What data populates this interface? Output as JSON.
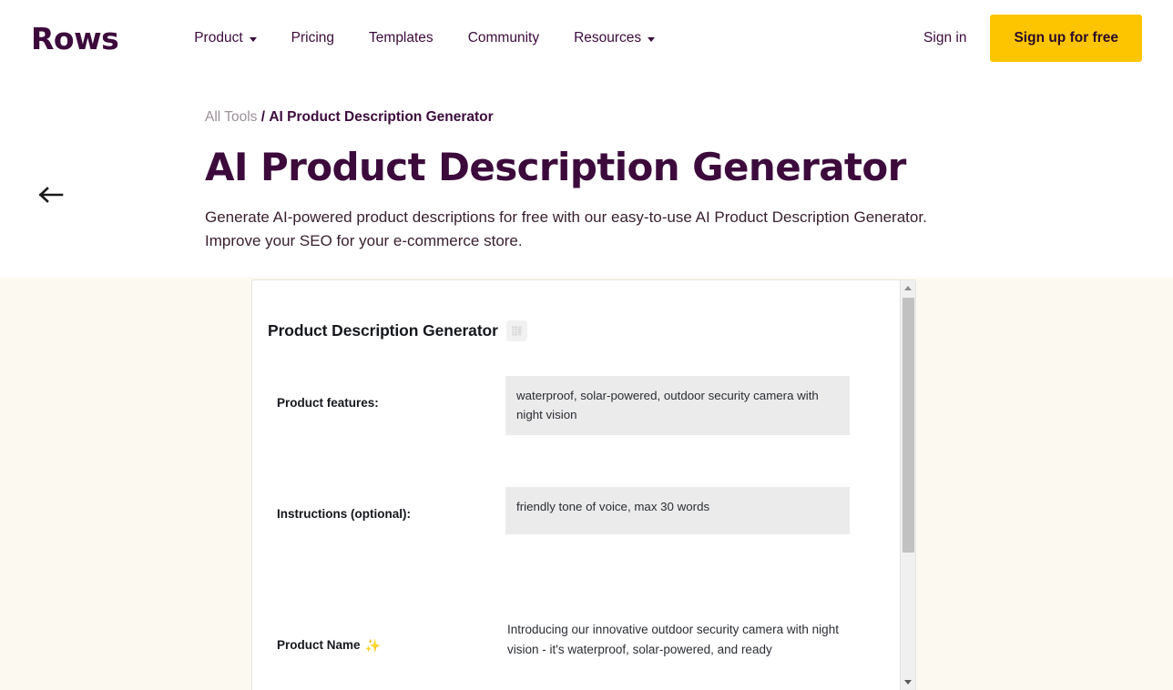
{
  "header": {
    "logo": "Rows",
    "nav": [
      {
        "label": "Product",
        "has_caret": true
      },
      {
        "label": "Pricing",
        "has_caret": false
      },
      {
        "label": "Templates",
        "has_caret": false
      },
      {
        "label": "Community",
        "has_caret": false
      },
      {
        "label": "Resources",
        "has_caret": true
      }
    ],
    "signin_label": "Sign in",
    "signup_label": "Sign up for free",
    "signup_color": "#FDC500",
    "brand_color": "#3C0B3C"
  },
  "hero": {
    "back_icon": "arrow-left-icon",
    "breadcrumb": {
      "all_tools": "All Tools",
      "separator": "/",
      "current": "AI Product Description Generator"
    },
    "title": "AI Product Description Generator",
    "description": "Generate AI-powered product descriptions for free with our easy-to-use AI Product Description Generator. Improve your SEO for your e-commerce store."
  },
  "tool": {
    "section_bg": "#FCF9F1",
    "widget_title": "Product Description Generator",
    "grid_icon": "spreadsheet-grid-icon",
    "rows": [
      {
        "label": "Product features:",
        "value": "waterproof, solar-powered, outdoor security camera with night vision",
        "type": "input"
      },
      {
        "label": "Instructions (optional):",
        "value": "friendly tone of voice, max 30 words",
        "type": "input"
      },
      {
        "label": "Product Name",
        "emoji": "✨",
        "value": "Introducing our innovative outdoor security camera with night vision - it's waterproof, solar-powered, and ready",
        "type": "output"
      }
    ],
    "scrollbar": {
      "up_icon": "scroll-up-arrow-icon",
      "down_icon": "scroll-down-arrow-icon"
    }
  }
}
